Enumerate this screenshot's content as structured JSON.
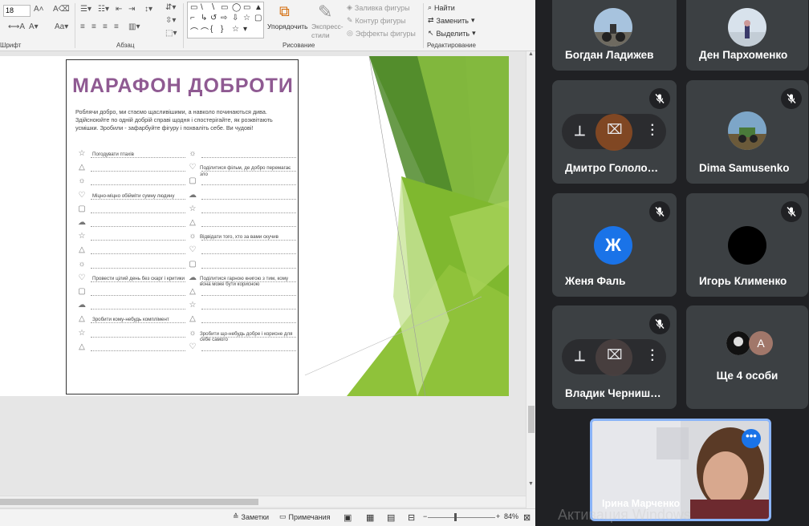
{
  "ribbon": {
    "font_size": "18",
    "groups": {
      "font": "Шрифт",
      "paragraph": "Абзац",
      "drawing": "Рисование",
      "editing": "Редактирование"
    },
    "arrange_label": "Упорядочить",
    "quick_styles_label": "Экспресс-стили",
    "shape_fill": "Заливка фигуры",
    "shape_outline": "Контур фигуры",
    "shape_effects": "Эффекты фигуры",
    "find": "Найти",
    "replace": "Заменить",
    "select": "Выделить"
  },
  "slide": {
    "title": "МАРАФОН ДОБРОТИ",
    "intro": "Роблячи добро, ми стаємо щасливішими, а навколо починаються дива. Здійсноюйте по одній добрій справі щодня і спостерігайте, як розквітають усмішки. Зробили - зафарбуйте фігуру і похваліть себе. Ви чудові!",
    "tasks": [
      "Погодувати птахів",
      "Поділитися фільм, де добро перемагає зло",
      "Міцно-міцно обійміти сумну людину",
      "Відвідати того, хто за вами скучив",
      "Провести цілий день без скарг і критики",
      "Поділитися гарною книгою з тим, кому вона може бути корисною",
      "Зробити кому-небудь комплімент",
      "Зробити що-небудь добре і корисне для себе самого"
    ]
  },
  "statusbar": {
    "notes": "Заметки",
    "comments": "Примечания",
    "zoom": "84%"
  },
  "participants": [
    {
      "name": "Богдан Ладижев",
      "muted": false
    },
    {
      "name": "Ден Пархоменко",
      "muted": false
    },
    {
      "name": "Дмитро Гололо…",
      "muted": true
    },
    {
      "name": "Dima Samusenko",
      "muted": true
    },
    {
      "name": "Женя Фаль",
      "muted": true,
      "initial": "Ж",
      "color": "#1a73e8"
    },
    {
      "name": "Игорь Клименко",
      "muted": true,
      "color": "#000000"
    },
    {
      "name": "Владик Черниш…",
      "muted": true
    },
    {
      "name": "Ще 4 особи",
      "muted": false,
      "initial": "A",
      "color": "#a1776a"
    }
  ],
  "self_view": {
    "name": "Ірина Марченко"
  },
  "watermark": "Активация Windows",
  "colors": {
    "meet_bg": "#202124",
    "tile_bg": "#3c4043",
    "title_purple": "#8f5a92",
    "green_dark": "#4f8a2a",
    "green_light": "#8fc23a",
    "accent_blue": "#1a73e8"
  }
}
